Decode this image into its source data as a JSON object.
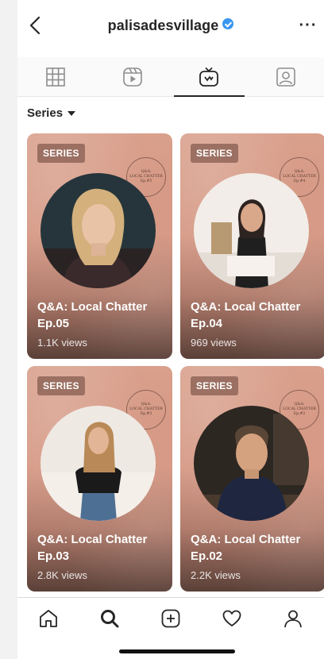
{
  "header": {
    "username": "palisadesvillage",
    "verified": true,
    "more_label": "···"
  },
  "tabs": [
    {
      "name": "grid",
      "icon": "grid-icon",
      "active": false
    },
    {
      "name": "reels",
      "icon": "reels-icon",
      "active": false
    },
    {
      "name": "igtv",
      "icon": "igtv-icon",
      "active": true
    },
    {
      "name": "tagged",
      "icon": "tagged-icon",
      "active": false
    }
  ],
  "filter": {
    "label": "Series"
  },
  "cards": [
    {
      "badge": "SERIES",
      "title": "Q&A: Local Chatter Ep.05",
      "views": "1.1K views",
      "stamp": [
        "Q&A:",
        "LOCAL CHATTER",
        "Ep.#5"
      ]
    },
    {
      "badge": "SERIES",
      "title": "Q&A: Local Chatter Ep.04",
      "views": "969 views",
      "stamp": [
        "Q&A:",
        "LOCAL CHATTER",
        "Ep.#4"
      ]
    },
    {
      "badge": "SERIES",
      "title": "Q&A: Local Chatter Ep.03",
      "views": "2.8K views",
      "stamp": [
        "Q&A:",
        "LOCAL CHATTER",
        "Ep.#3"
      ]
    },
    {
      "badge": "SERIES",
      "title": "Q&A: Local Chatter Ep.02",
      "views": "2.2K views",
      "stamp": [
        "Q&A:",
        "LOCAL CHATTER",
        "Ep.#2"
      ]
    }
  ],
  "bottom_nav": [
    {
      "name": "home",
      "icon": "home-icon"
    },
    {
      "name": "search",
      "icon": "search-icon",
      "active": true
    },
    {
      "name": "create",
      "icon": "plus-square-icon"
    },
    {
      "name": "activity",
      "icon": "heart-icon"
    },
    {
      "name": "profile",
      "icon": "profile-icon"
    }
  ],
  "colors": {
    "accent": "#3897f0",
    "card_top": "#d9a08c",
    "card_bottom": "#5a4038"
  }
}
